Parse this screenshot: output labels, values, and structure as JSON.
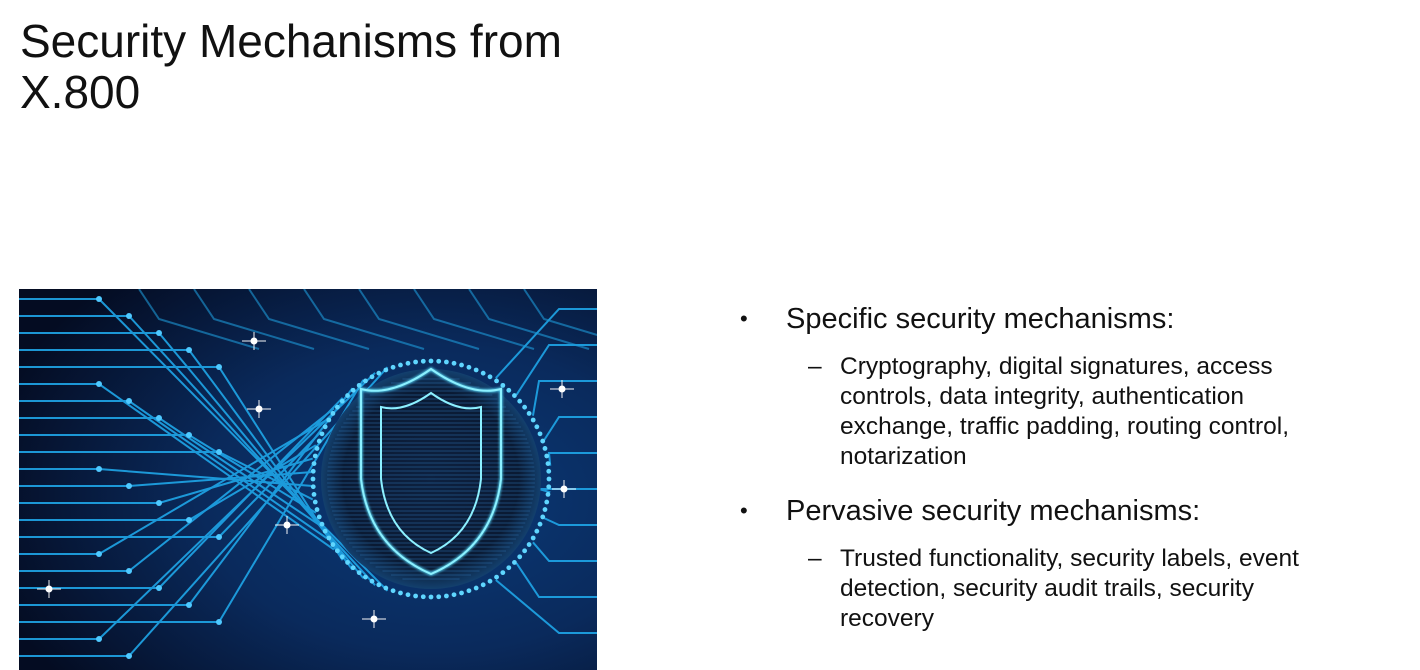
{
  "slide": {
    "title_line1": "Security Mechanisms from",
    "title_line2": "X.800",
    "image": {
      "icon": "shield-circuit-icon",
      "colors": {
        "background": "#06132e",
        "circuit": "#1fa6e8",
        "glow": "#6ee7ff"
      }
    },
    "bullets": [
      {
        "label": "Specific security mechanisms:",
        "sub": "Cryptography, digital signatures, access controls, data integrity, authentication exchange, traffic padding, routing control, notarization"
      },
      {
        "label": "Pervasive security mechanisms:",
        "sub": "Trusted functionality, security labels, event detection, security audit trails, security recovery"
      }
    ],
    "bullet_glyph": "•",
    "dash_glyph": "–"
  }
}
